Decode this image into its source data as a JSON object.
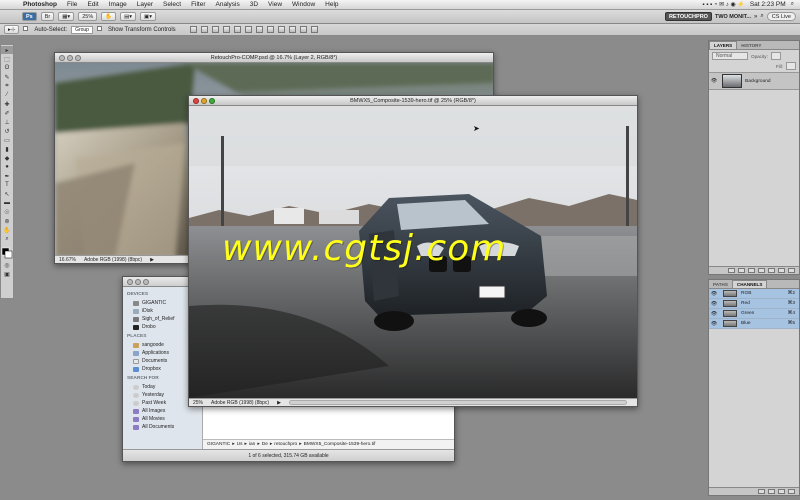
{
  "menubar": {
    "app": "Photoshop",
    "items": [
      "File",
      "Edit",
      "Image",
      "Layer",
      "Select",
      "Filter",
      "Analysis",
      "3D",
      "View",
      "Window",
      "Help"
    ],
    "clock": "Sat 2:23 PM"
  },
  "appbar": {
    "zoom": "25%",
    "workspace_active": "RETOUCHPRO",
    "workspace_other": "TWO MONIT...",
    "cs_live": "CS Live"
  },
  "options": {
    "auto_select_label": "Auto-Select:",
    "auto_select_value": "Group",
    "transform_label": "Show Transform Controls"
  },
  "back_window": {
    "title": "RetouchPro-COMP.psd @ 16.7% (Layer 2, RGB/8*)",
    "zoom": "16.67%",
    "profile": "Adobe RGB (1998) (8bpc)"
  },
  "front_window": {
    "title": "BMWX5_Composite-1539-hero.tif @ 25% (RGB/8*)",
    "zoom": "25%",
    "profile": "Adobe RGB (1998) (8bpc)"
  },
  "finder": {
    "sections": [
      {
        "title": "DEVICES",
        "items": [
          "GIGANTIC",
          "iDisk",
          "Sigh_of_Relief",
          "Drobo"
        ]
      },
      {
        "title": "PLACES",
        "items": [
          "sangoode",
          "Applications",
          "Documents",
          "Dropbox"
        ]
      },
      {
        "title": "SEARCH FOR",
        "items": [
          "Today",
          "Yesterday",
          "Past Week",
          "All Images",
          "All Movies",
          "All Documents"
        ]
      }
    ],
    "path": [
      "GIGANTIC",
      "Us",
      "ian",
      "De",
      "retouchpro",
      "BMWX5_Composite-1539-hero.tif"
    ],
    "status": "1 of 6 selected, 315.74 GB available"
  },
  "layers_panel": {
    "tabs": [
      "LAYERS",
      "HISTORY"
    ],
    "blend": "Normal",
    "opacity_label": "Opacity:",
    "fill_label": "Fill:",
    "layer": "Background"
  },
  "channels_panel": {
    "tabs": [
      "PATHS",
      "CHANNELS"
    ],
    "channels": [
      {
        "name": "RGB",
        "key": "⌘2"
      },
      {
        "name": "Red",
        "key": "⌘3"
      },
      {
        "name": "Green",
        "key": "⌘4"
      },
      {
        "name": "Blue",
        "key": "⌘5"
      }
    ]
  },
  "watermark": "www.cgtsj.com",
  "colors": {
    "selection_blue": "#a7c3e2",
    "watermark_yellow": "#ffff1a"
  }
}
